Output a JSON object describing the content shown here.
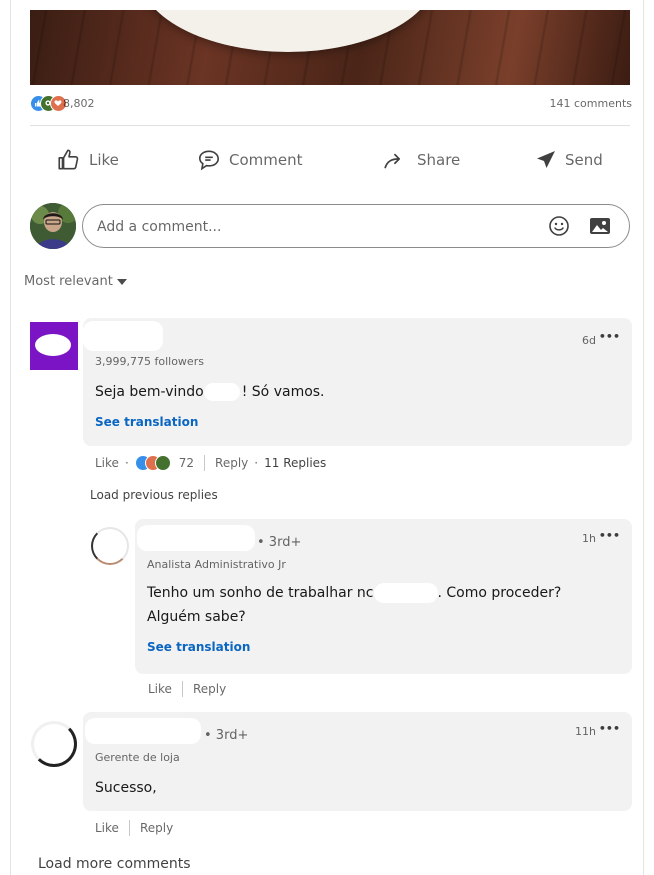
{
  "social": {
    "reactions_count": "8,802",
    "comments_count": "141 comments"
  },
  "actions": {
    "like": "Like",
    "comment": "Comment",
    "share": "Share",
    "send": "Send"
  },
  "composer": {
    "placeholder": "Add a comment..."
  },
  "sort": {
    "label": "Most relevant"
  },
  "comments": [
    {
      "time": "6d",
      "followers": "3,999,775 followers",
      "text_before": "Seja bem-vindo",
      "text_after": "! Só vamos.",
      "see_translation": "See translation",
      "like": "Like",
      "reaction_count": "72",
      "reply": "Reply",
      "replies": "11 Replies",
      "load_previous": "Load previous replies",
      "replies_list": [
        {
          "degree": "• 3rd+",
          "time": "1h",
          "headline": "Analista Administrativo Jr",
          "text_line1_before": "Tenho um sonho de trabalhar nc",
          "text_line1_after": ". Como proceder?",
          "text_line2": "Alguém sabe?",
          "see_translation": "See translation",
          "like": "Like",
          "reply": "Reply"
        }
      ]
    },
    {
      "degree": "• 3rd+",
      "time": "11h",
      "headline": "Gerente de loja",
      "text": "Sucesso,",
      "like": "Like",
      "reply": "Reply"
    }
  ],
  "load_more": "Load more comments",
  "colors": {
    "accent": "#0a66c2",
    "like_reaction": "#378fe9",
    "celebrate_reaction": "#44712e",
    "love_reaction": "#df704d",
    "company_avatar": "#7b14c5"
  }
}
